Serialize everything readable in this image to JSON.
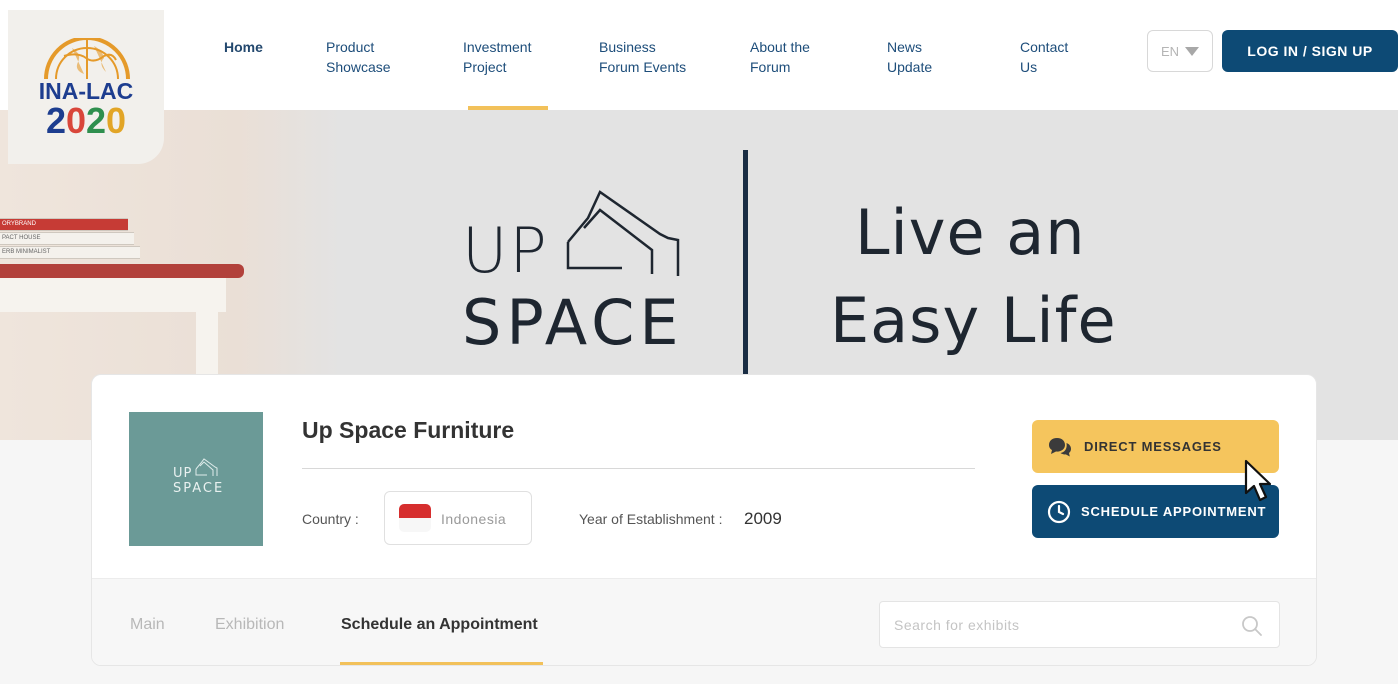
{
  "logo": {
    "line1": "INA-LAC",
    "year_digits": [
      "2",
      "0",
      "2",
      "0"
    ]
  },
  "nav": {
    "items": [
      {
        "label": "Home",
        "active": false
      },
      {
        "label": "Product\nShowcase"
      },
      {
        "label": "Investment\nProject",
        "active": true
      },
      {
        "label": "Business\nForum Events"
      },
      {
        "label": "About the\nForum"
      },
      {
        "label": "News\nUpdate"
      },
      {
        "label": "Contact\nUs"
      }
    ],
    "language": "EN",
    "login_label": "LOG IN / SIGN UP"
  },
  "banner": {
    "brand_line1": "UP",
    "brand_line2": "SPACE",
    "tagline_line1": "Live an",
    "tagline_line2": "Easy Life",
    "books": [
      "ORYBRAND",
      "PACT HOUSE",
      "ERB MINIMALIST"
    ]
  },
  "company": {
    "logo_line1": "UP",
    "logo_line2": "SPACE",
    "name": "Up Space Furniture",
    "country_label": "Country :",
    "country": "Indonesia",
    "year_label": "Year of Establishment :",
    "year": "2009"
  },
  "actions": {
    "direct_messages": "DIRECT MESSAGES",
    "schedule_appointment": "SCHEDULE APPOINTMENT"
  },
  "tabs": {
    "items": [
      {
        "label": "Main"
      },
      {
        "label": "Exhibition"
      },
      {
        "label": "Schedule an Appointment",
        "active": true
      }
    ]
  },
  "search": {
    "placeholder": "Search for exhibits"
  },
  "colors": {
    "primary": "#0d4a75",
    "accent": "#f5c55d",
    "active_underline": "#f2c15a",
    "company_logo_bg": "#6b9a97"
  }
}
